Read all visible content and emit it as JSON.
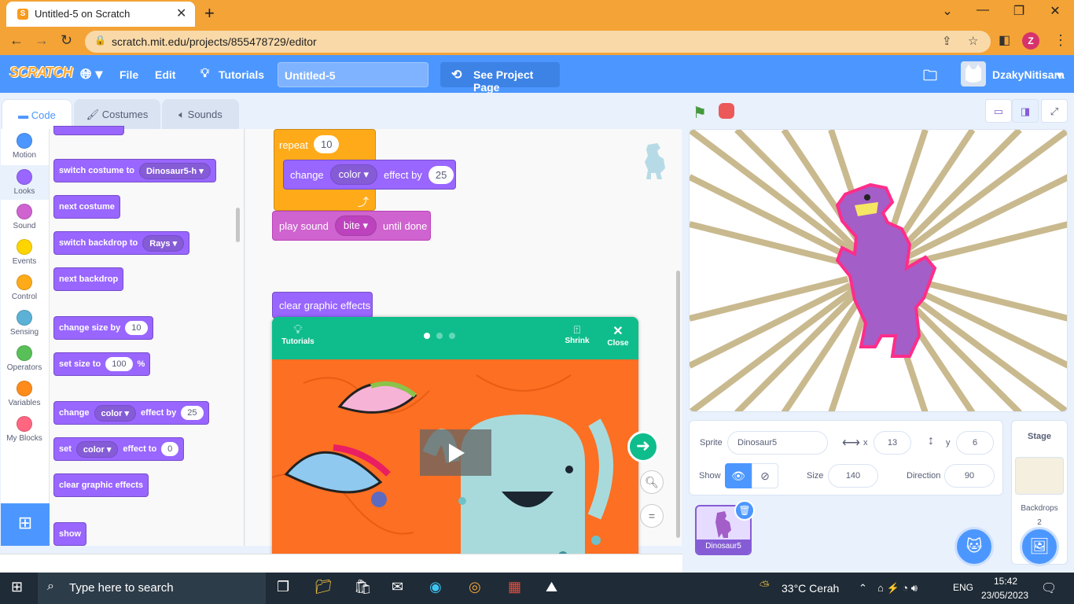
{
  "browser": {
    "tab_title": "Untitled-5 on Scratch",
    "new_tab": "+",
    "url": "scratch.mit.edu/projects/855478729/editor",
    "profile_initial": "Z"
  },
  "menubar": {
    "logo": "SCRATCH",
    "file": "File",
    "edit": "Edit",
    "tutorials": "Tutorials",
    "project_title": "Untitled-5",
    "see_project": "See Project Page",
    "username": "DzakyNitisara"
  },
  "tabs": {
    "code": "Code",
    "costumes": "Costumes",
    "sounds": "Sounds"
  },
  "categories": [
    {
      "label": "Motion",
      "color": "#4c97ff"
    },
    {
      "label": "Looks",
      "color": "#9966ff"
    },
    {
      "label": "Sound",
      "color": "#cf63cf"
    },
    {
      "label": "Events",
      "color": "#ffd500"
    },
    {
      "label": "Control",
      "color": "#ffab19"
    },
    {
      "label": "Sensing",
      "color": "#5cb1d6"
    },
    {
      "label": "Operators",
      "color": "#59c059"
    },
    {
      "label": "Variables",
      "color": "#ff8c1a"
    },
    {
      "label": "My Blocks",
      "color": "#ff6680"
    }
  ],
  "palette": {
    "switch_costume": "switch costume to",
    "costume_value": "Dinosaur5-h",
    "next_costume": "next costume",
    "switch_backdrop": "switch backdrop to",
    "backdrop_value": "Rays",
    "next_backdrop": "next backdrop",
    "change_size": "change size by",
    "change_size_value": "10",
    "set_size": "set size to",
    "set_size_value": "100",
    "percent": "%",
    "change_effect": "change",
    "effect_name": "color",
    "effect_by": "effect by",
    "effect_value": "25",
    "set_effect": "set",
    "set_effect_name": "color",
    "effect_to": "effect to",
    "set_effect_value": "0",
    "clear_effects": "clear graphic effects",
    "show": "show"
  },
  "workspace": {
    "repeat": "repeat",
    "repeat_value": "10",
    "change": "change",
    "effect_name": "color",
    "effect_by": "effect by",
    "effect_value": "25",
    "play_sound": "play sound",
    "sound_name": "bite",
    "until_done": "until done",
    "clear_effects": "clear graphic effects"
  },
  "tutorial_card": {
    "tutorials": "Tutorials",
    "shrink": "Shrink",
    "close": "Close"
  },
  "sprite_info": {
    "sprite_label": "Sprite",
    "sprite_name": "Dinosaur5",
    "x_label": "x",
    "x_value": "13",
    "y_label": "y",
    "y_value": "6",
    "show_label": "Show",
    "size_label": "Size",
    "size_value": "140",
    "direction_label": "Direction",
    "direction_value": "90"
  },
  "sprites": [
    {
      "name": "Dinosaur5"
    }
  ],
  "stage_panel": {
    "title": "Stage",
    "backdrops_label": "Backdrops",
    "backdrops_count": "2"
  },
  "taskbar": {
    "search_placeholder": "Type here to search",
    "weather": "33°C Cerah",
    "lang": "ENG",
    "time": "15:42",
    "date": "23/05/2023"
  }
}
